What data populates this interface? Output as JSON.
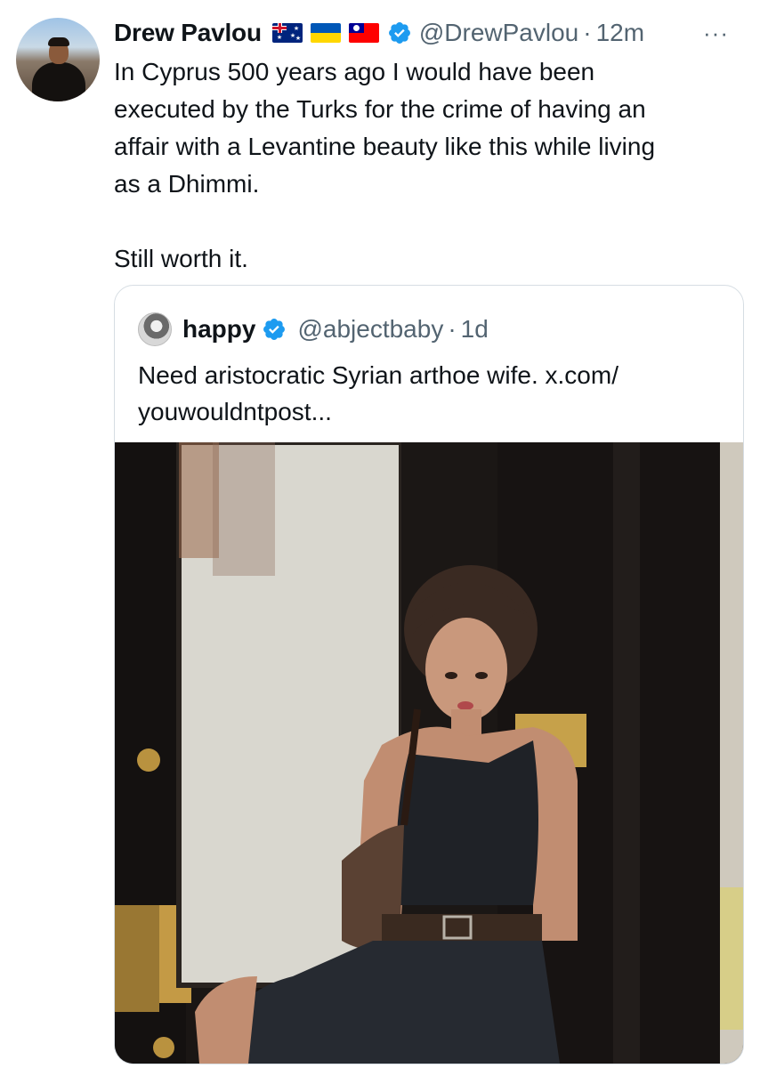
{
  "tweet": {
    "author_name": "Drew Pavlou",
    "flags": [
      "australia-flag-icon",
      "ukraine-flag-icon",
      "taiwan-flag-icon"
    ],
    "handle": "@DrewPavlou",
    "separator": "·",
    "time": "12m",
    "more_label": "···",
    "text": "In Cyprus 500 years ago I would have been\nexecuted by the Turks for the crime of having an\naffair with a Levantine beauty like this while living\nas a Dhimmi.\n\nStill worth it."
  },
  "quoted": {
    "author_name": "happy",
    "handle": "@abjectbaby",
    "separator": "·",
    "time": "1d",
    "text": "Need aristocratic Syrian arthoe wife. x.com/\nyouwouldntpost...",
    "media": "photo of a young woman with short wavy hair in a black top sitting in a dark doorway"
  },
  "colors": {
    "verified_blue": "#1d9bf0",
    "secondary_text": "#536471",
    "primary_text": "#0f1419",
    "border": "#d6dde3"
  }
}
